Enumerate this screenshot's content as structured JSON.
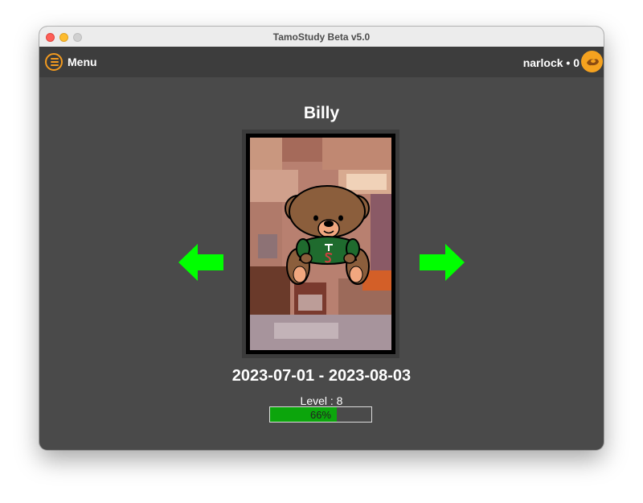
{
  "window": {
    "title": "TamoStudy Beta v5.0"
  },
  "topbar": {
    "menu_label": "Menu",
    "user_info": "narlock • 0"
  },
  "pet": {
    "name": "Billy",
    "date_range": "2023-07-01 - 2023-08-03",
    "level_label": "Level : 8",
    "progress_percent": 66,
    "progress_label": "66%"
  },
  "icons": {
    "menu": "hamburger-menu-icon",
    "coin": "coin-icon",
    "prev": "left-arrow-icon",
    "next": "right-arrow-icon"
  },
  "colors": {
    "accent_orange": "#f29a1f",
    "arrow_green": "#00ff00",
    "progress_green": "#0ca50c",
    "background": "#4a4a4a"
  }
}
